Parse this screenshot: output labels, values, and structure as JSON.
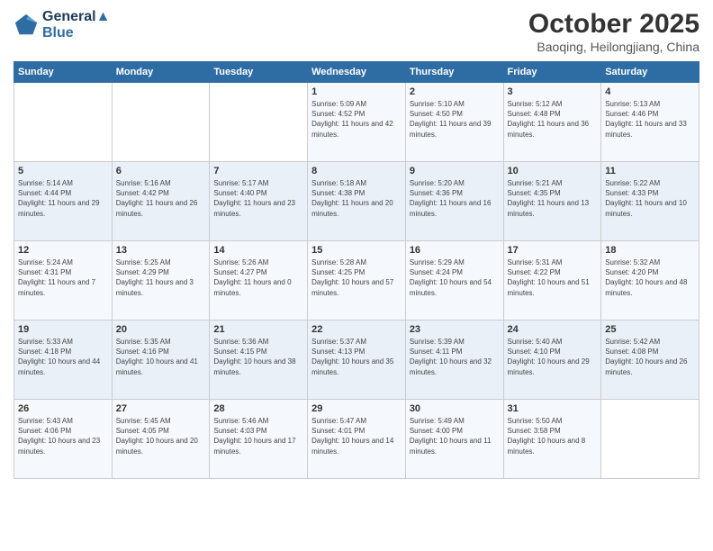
{
  "header": {
    "logo_line1": "General",
    "logo_line2": "Blue",
    "month": "October 2025",
    "location": "Baoqing, Heilongjiang, China"
  },
  "weekdays": [
    "Sunday",
    "Monday",
    "Tuesday",
    "Wednesday",
    "Thursday",
    "Friday",
    "Saturday"
  ],
  "weeks": [
    [
      {
        "day": "",
        "info": ""
      },
      {
        "day": "",
        "info": ""
      },
      {
        "day": "",
        "info": ""
      },
      {
        "day": "1",
        "info": "Sunrise: 5:09 AM\nSunset: 4:52 PM\nDaylight: 11 hours and 42 minutes."
      },
      {
        "day": "2",
        "info": "Sunrise: 5:10 AM\nSunset: 4:50 PM\nDaylight: 11 hours and 39 minutes."
      },
      {
        "day": "3",
        "info": "Sunrise: 5:12 AM\nSunset: 4:48 PM\nDaylight: 11 hours and 36 minutes."
      },
      {
        "day": "4",
        "info": "Sunrise: 5:13 AM\nSunset: 4:46 PM\nDaylight: 11 hours and 33 minutes."
      }
    ],
    [
      {
        "day": "5",
        "info": "Sunrise: 5:14 AM\nSunset: 4:44 PM\nDaylight: 11 hours and 29 minutes."
      },
      {
        "day": "6",
        "info": "Sunrise: 5:16 AM\nSunset: 4:42 PM\nDaylight: 11 hours and 26 minutes."
      },
      {
        "day": "7",
        "info": "Sunrise: 5:17 AM\nSunset: 4:40 PM\nDaylight: 11 hours and 23 minutes."
      },
      {
        "day": "8",
        "info": "Sunrise: 5:18 AM\nSunset: 4:38 PM\nDaylight: 11 hours and 20 minutes."
      },
      {
        "day": "9",
        "info": "Sunrise: 5:20 AM\nSunset: 4:36 PM\nDaylight: 11 hours and 16 minutes."
      },
      {
        "day": "10",
        "info": "Sunrise: 5:21 AM\nSunset: 4:35 PM\nDaylight: 11 hours and 13 minutes."
      },
      {
        "day": "11",
        "info": "Sunrise: 5:22 AM\nSunset: 4:33 PM\nDaylight: 11 hours and 10 minutes."
      }
    ],
    [
      {
        "day": "12",
        "info": "Sunrise: 5:24 AM\nSunset: 4:31 PM\nDaylight: 11 hours and 7 minutes."
      },
      {
        "day": "13",
        "info": "Sunrise: 5:25 AM\nSunset: 4:29 PM\nDaylight: 11 hours and 3 minutes."
      },
      {
        "day": "14",
        "info": "Sunrise: 5:26 AM\nSunset: 4:27 PM\nDaylight: 11 hours and 0 minutes."
      },
      {
        "day": "15",
        "info": "Sunrise: 5:28 AM\nSunset: 4:25 PM\nDaylight: 10 hours and 57 minutes."
      },
      {
        "day": "16",
        "info": "Sunrise: 5:29 AM\nSunset: 4:24 PM\nDaylight: 10 hours and 54 minutes."
      },
      {
        "day": "17",
        "info": "Sunrise: 5:31 AM\nSunset: 4:22 PM\nDaylight: 10 hours and 51 minutes."
      },
      {
        "day": "18",
        "info": "Sunrise: 5:32 AM\nSunset: 4:20 PM\nDaylight: 10 hours and 48 minutes."
      }
    ],
    [
      {
        "day": "19",
        "info": "Sunrise: 5:33 AM\nSunset: 4:18 PM\nDaylight: 10 hours and 44 minutes."
      },
      {
        "day": "20",
        "info": "Sunrise: 5:35 AM\nSunset: 4:16 PM\nDaylight: 10 hours and 41 minutes."
      },
      {
        "day": "21",
        "info": "Sunrise: 5:36 AM\nSunset: 4:15 PM\nDaylight: 10 hours and 38 minutes."
      },
      {
        "day": "22",
        "info": "Sunrise: 5:37 AM\nSunset: 4:13 PM\nDaylight: 10 hours and 35 minutes."
      },
      {
        "day": "23",
        "info": "Sunrise: 5:39 AM\nSunset: 4:11 PM\nDaylight: 10 hours and 32 minutes."
      },
      {
        "day": "24",
        "info": "Sunrise: 5:40 AM\nSunset: 4:10 PM\nDaylight: 10 hours and 29 minutes."
      },
      {
        "day": "25",
        "info": "Sunrise: 5:42 AM\nSunset: 4:08 PM\nDaylight: 10 hours and 26 minutes."
      }
    ],
    [
      {
        "day": "26",
        "info": "Sunrise: 5:43 AM\nSunset: 4:06 PM\nDaylight: 10 hours and 23 minutes."
      },
      {
        "day": "27",
        "info": "Sunrise: 5:45 AM\nSunset: 4:05 PM\nDaylight: 10 hours and 20 minutes."
      },
      {
        "day": "28",
        "info": "Sunrise: 5:46 AM\nSunset: 4:03 PM\nDaylight: 10 hours and 17 minutes."
      },
      {
        "day": "29",
        "info": "Sunrise: 5:47 AM\nSunset: 4:01 PM\nDaylight: 10 hours and 14 minutes."
      },
      {
        "day": "30",
        "info": "Sunrise: 5:49 AM\nSunset: 4:00 PM\nDaylight: 10 hours and 11 minutes."
      },
      {
        "day": "31",
        "info": "Sunrise: 5:50 AM\nSunset: 3:58 PM\nDaylight: 10 hours and 8 minutes."
      },
      {
        "day": "",
        "info": ""
      }
    ]
  ]
}
